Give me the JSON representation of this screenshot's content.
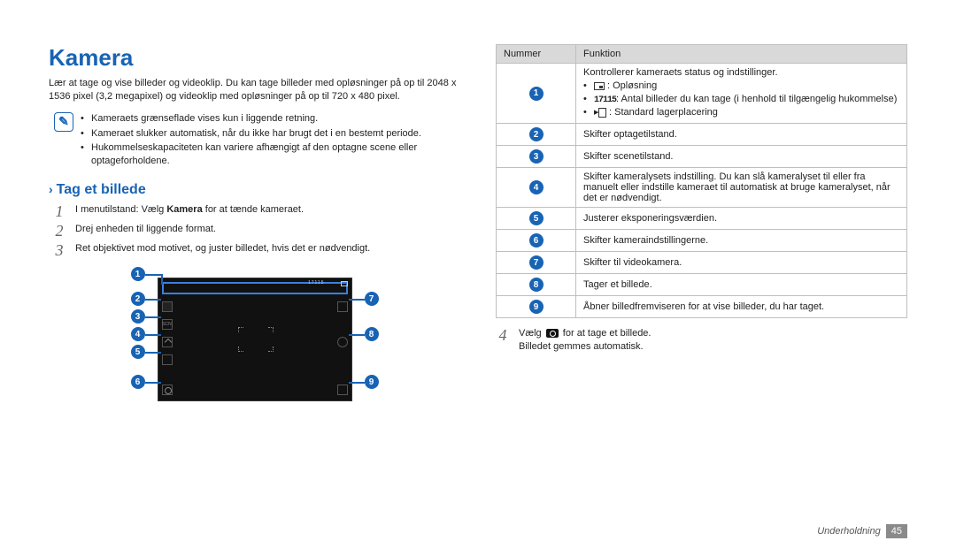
{
  "title": "Kamera",
  "intro": "Lær at tage og vise billeder og videoklip. Du kan tage billeder med opløsninger på op til 2048 x 1536 pixel (3,2 megapixel) og videoklip med opløsninger på op til 720 x 480 pixel.",
  "notes": [
    "Kameraets grænseflade vises kun i liggende retning.",
    "Kameraet slukker automatisk, når du ikke har brugt det i en bestemt periode.",
    "Hukommelseskapaciteten kan variere afhængigt af den optagne scene eller optageforholdene."
  ],
  "sub_chevron": "›",
  "sub_title": "Tag et billede",
  "steps": {
    "s1_pre": "I menutilstand: Vælg ",
    "s1_bold": "Kamera",
    "s1_post": " for at tænde kameraet.",
    "s2": "Drej enheden til liggende format.",
    "s3": "Ret objektivet mod motivet, og juster billedet, hvis det er nødvendigt."
  },
  "diagram_scn": "SCN",
  "diagram_count": "17115",
  "table": {
    "h1": "Nummer",
    "h2": "Funktion",
    "r1_main": "Kontrollerer kameraets status og indstillinger.",
    "r1_a": ": Opløsning",
    "r1_b": ": Antal billeder du kan tage (i henhold til tilgængelig hukommelse)",
    "r1_c": ": Standard lagerplacering",
    "r2": "Skifter optagetilstand.",
    "r3": "Skifter scenetilstand.",
    "r4": "Skifter kameralysets indstilling. Du kan slå kameralyset til eller fra manuelt eller indstille kameraet til automatisk at bruge kameralyset, når det er nødvendigt.",
    "r5": "Justerer eksponeringsværdien.",
    "r6": "Skifter kameraindstillingerne.",
    "r7": "Skifter til videokamera.",
    "r8": "Tager et billede.",
    "r9": "Åbner billedfremviseren for at vise billeder, du har taget."
  },
  "step4_a": "Vælg ",
  "step4_b": " for at tage et billede.",
  "step4_c": "Billedet gemmes automatisk.",
  "footer_section": "Underholdning",
  "footer_page": "45",
  "badge_labels": [
    "1",
    "2",
    "3",
    "4",
    "5",
    "6",
    "7",
    "8",
    "9"
  ]
}
